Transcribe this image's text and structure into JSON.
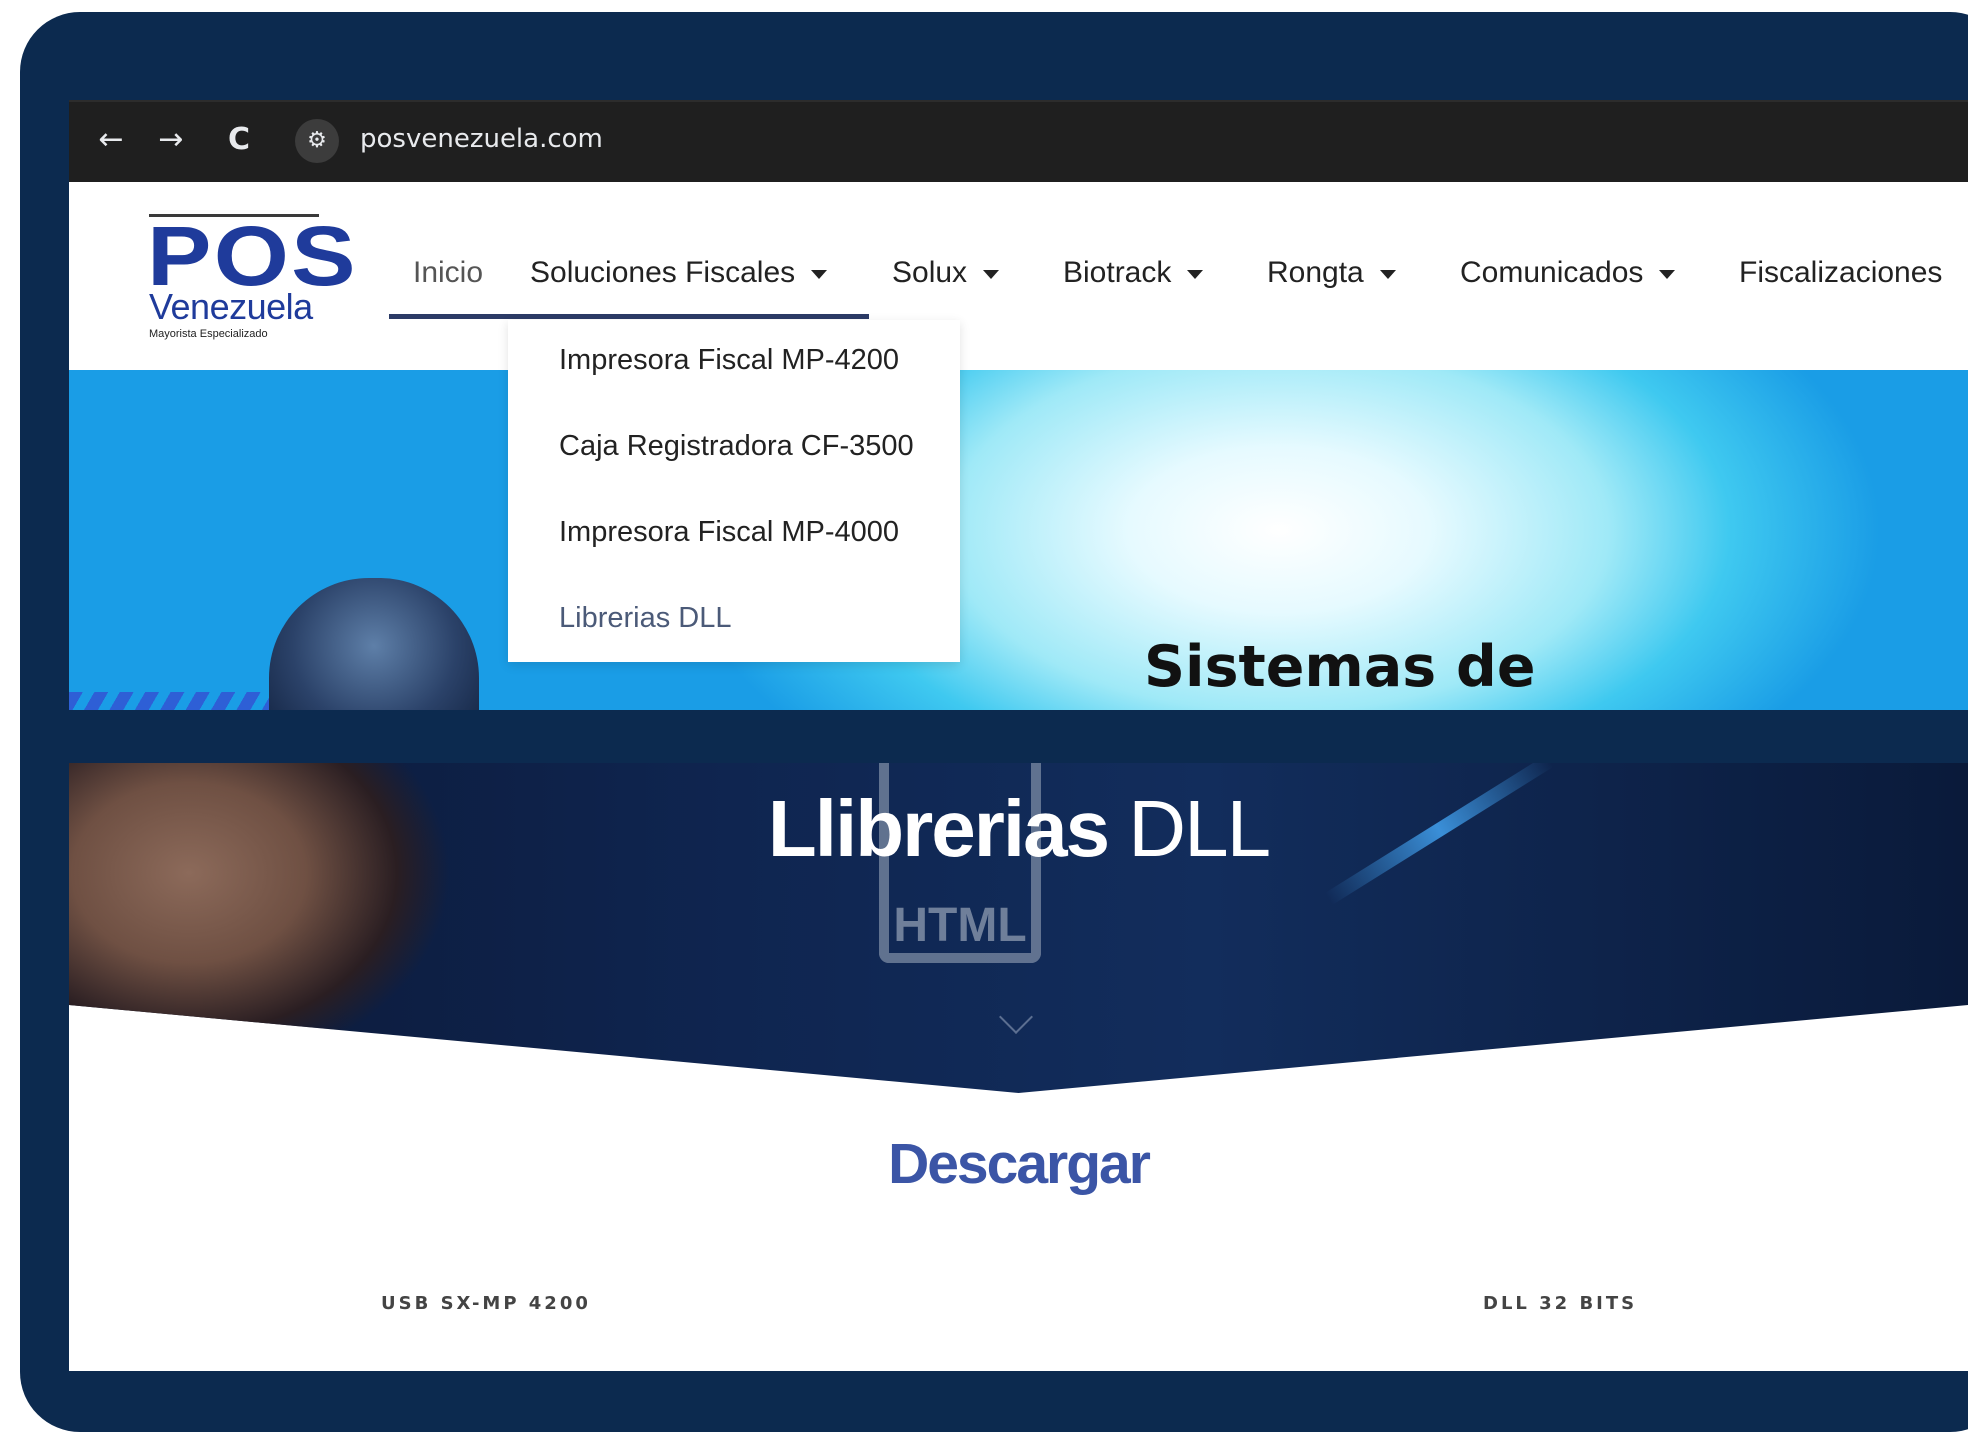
{
  "browser": {
    "back_glyph": "←",
    "forward_glyph": "→",
    "reload_glyph": "C",
    "site_info_glyph": "⚙",
    "url": "posvenezuela.com"
  },
  "logo": {
    "main": "POS",
    "sub": "Venezuela",
    "tagline": "Mayorista Especializado"
  },
  "nav": {
    "items": [
      {
        "label": "Inicio",
        "has_caret": false
      },
      {
        "label": "Soluciones Fiscales",
        "has_caret": true
      },
      {
        "label": "Solux",
        "has_caret": true
      },
      {
        "label": "Biotrack",
        "has_caret": true
      },
      {
        "label": "Rongta",
        "has_caret": true
      },
      {
        "label": "Comunicados",
        "has_caret": true
      },
      {
        "label": "Fiscalizaciones",
        "has_caret": false
      }
    ]
  },
  "dropdown": {
    "items": [
      "Impresora Fiscal MP-4200",
      "Caja Registradora CF-3500",
      "Impresora Fiscal MP-4000",
      "Librerias DLL"
    ],
    "active_index": 3
  },
  "hero": {
    "title": "Sistemas de"
  },
  "banner": {
    "title_bold": "Llibrerias",
    "title_rest": " DLL",
    "icon_label": "HTML"
  },
  "downloads": {
    "heading": "Descargar",
    "links": [
      "USB SX-MP 4200",
      "DLL 32 BITS"
    ]
  },
  "colors": {
    "frame": "#0c2a4f",
    "brand_blue": "#1f3b9b",
    "heading_blue": "#3b55a6",
    "nav_underline": "#2c3b66"
  }
}
